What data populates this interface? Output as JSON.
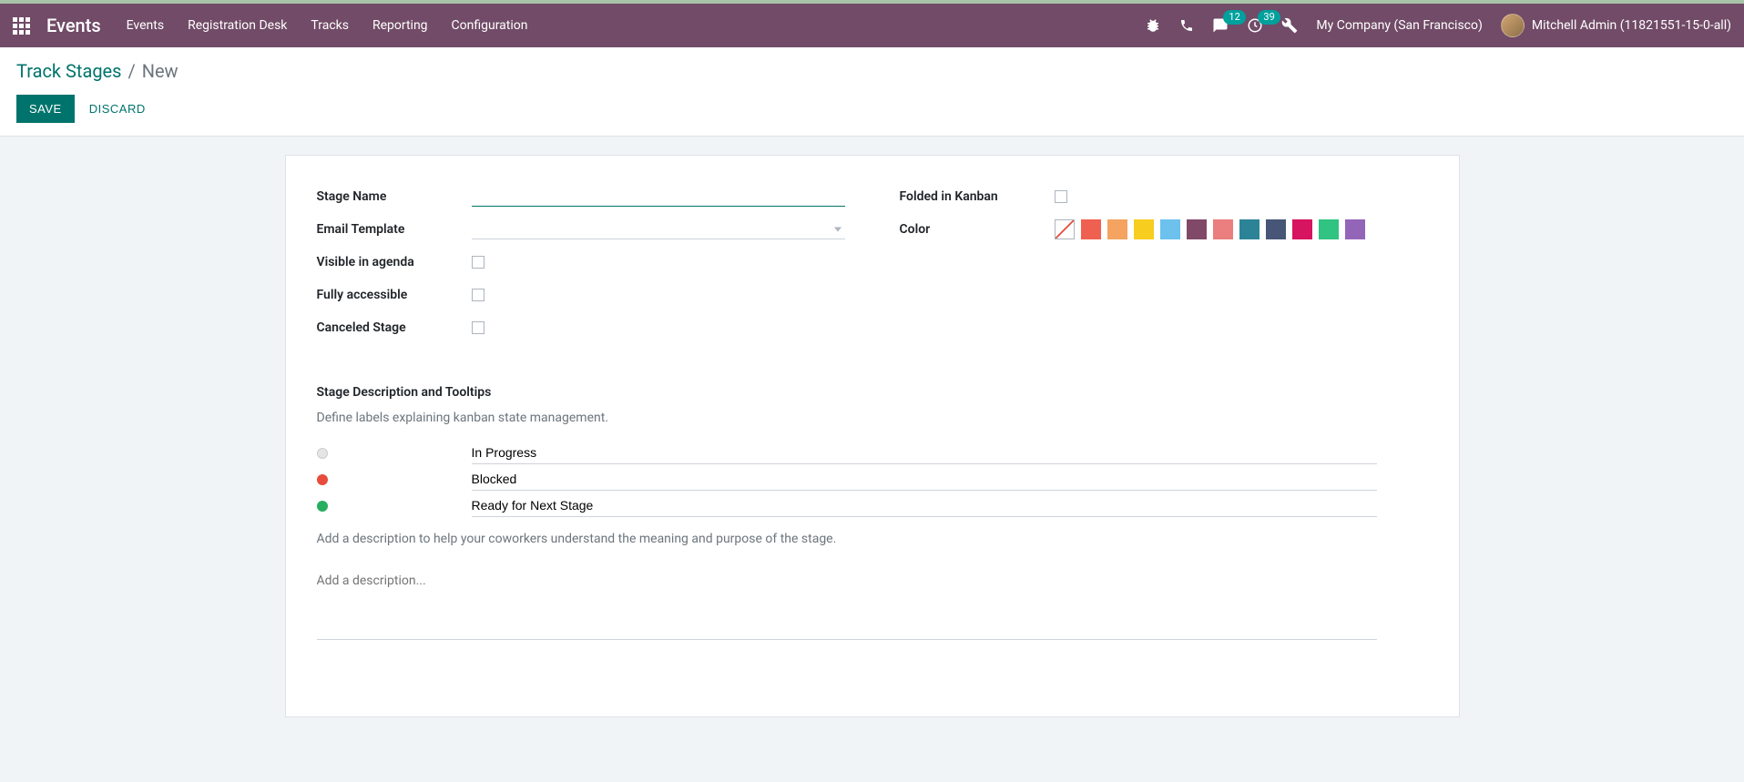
{
  "topbar": {
    "app_name": "Events",
    "menu": [
      "Events",
      "Registration Desk",
      "Tracks",
      "Reporting",
      "Configuration"
    ],
    "messages_badge": "12",
    "activities_badge": "39",
    "company": "My Company (San Francisco)",
    "user": "Mitchell Admin (11821551-15-0-all)"
  },
  "breadcrumb": {
    "parent": "Track Stages",
    "current": "New"
  },
  "buttons": {
    "save": "SAVE",
    "discard": "DISCARD"
  },
  "form": {
    "labels": {
      "stage_name": "Stage Name",
      "email_template": "Email Template",
      "visible_in_agenda": "Visible in agenda",
      "fully_accessible": "Fully accessible",
      "canceled_stage": "Canceled Stage",
      "folded_in_kanban": "Folded in Kanban",
      "color": "Color"
    },
    "values": {
      "stage_name": "",
      "email_template": ""
    },
    "colors": [
      "#f06050",
      "#f4a460",
      "#f7cd1f",
      "#6cc1ed",
      "#814968",
      "#eb7e7f",
      "#2c8397",
      "#475577",
      "#d6145f",
      "#30c381",
      "#9365b8"
    ]
  },
  "tooltips_section": {
    "title": "Stage Description and Tooltips",
    "help": "Define labels explaining kanban state management.",
    "states": [
      {
        "color": "grey",
        "label": "In Progress"
      },
      {
        "color": "red",
        "label": "Blocked"
      },
      {
        "color": "green",
        "label": "Ready for Next Stage"
      }
    ],
    "desc_help": "Add a description to help your coworkers understand the meaning and purpose of the stage.",
    "desc_placeholder": "Add a description..."
  }
}
